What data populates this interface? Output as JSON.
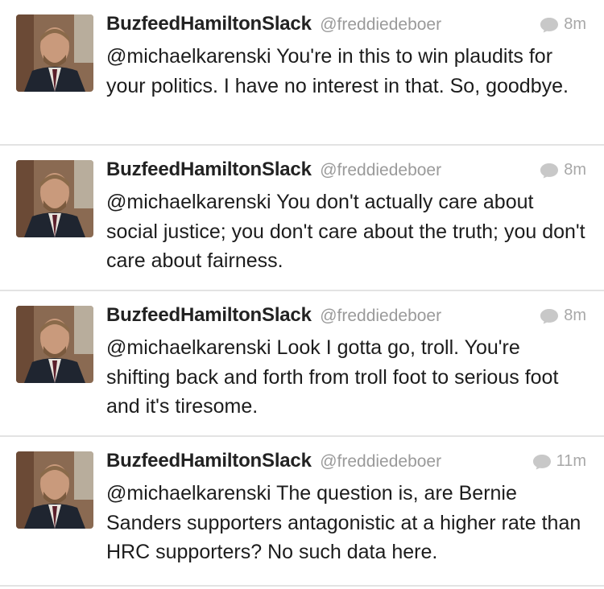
{
  "tweets": [
    {
      "name": "BuzfeedHamiltonSlack",
      "handle": "@freddiedeboer",
      "time": "8m",
      "text": "@michaelkarenski You're in this to win plaudits for your politics. I have no interest in that. So, goodbye."
    },
    {
      "name": "BuzfeedHamiltonSlack",
      "handle": "@freddiedeboer",
      "time": "8m",
      "text": "@michaelkarenski You don't actually care about social justice; you don't care about the truth; you don't care about fairness."
    },
    {
      "name": "BuzfeedHamiltonSlack",
      "handle": "@freddiedeboer",
      "time": "8m",
      "text": "@michaelkarenski Look I gotta go, troll. You're shifting back and forth from troll foot to serious foot and it's tiresome."
    },
    {
      "name": "BuzfeedHamiltonSlack",
      "handle": "@freddiedeboer",
      "time": "11m",
      "text": "@michaelkarenski The question is, are Bernie Sanders supporters antagonistic at a higher rate than HRC supporters? No such data here."
    }
  ],
  "icons": {
    "avatar": "profile-photo",
    "reply": "speech-bubble-icon"
  },
  "colors": {
    "name": "#222222",
    "handle": "#9a9a9a",
    "meta": "#a8a8a8",
    "divider": "#e3e3e3"
  }
}
